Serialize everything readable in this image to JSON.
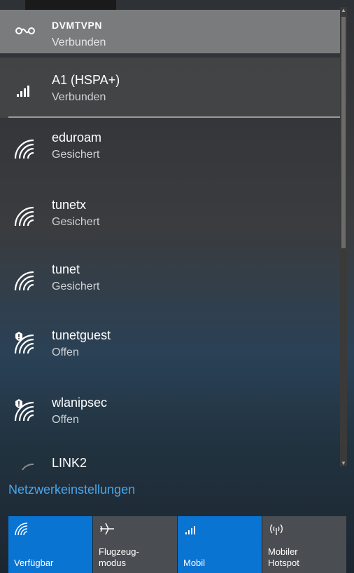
{
  "vpn": {
    "name": "DVMTVPN",
    "status": "Verbunden"
  },
  "cellular": {
    "name": "A1 (HSPA+)",
    "status": "Verbunden"
  },
  "wifi": [
    {
      "name": "eduroam",
      "status": "Gesichert",
      "secured": true
    },
    {
      "name": "tunetx",
      "status": "Gesichert",
      "secured": true
    },
    {
      "name": "tunet",
      "status": "Gesichert",
      "secured": true
    },
    {
      "name": "tunetguest",
      "status": "Offen",
      "secured": false
    },
    {
      "name": "wlanipsec",
      "status": "Offen",
      "secured": false
    },
    {
      "name": "LINK2",
      "status": "",
      "secured": true
    }
  ],
  "settings_link": "Netzwerkeinstellungen",
  "tiles": [
    {
      "label": "Verfügbar",
      "icon": "wifi-icon",
      "active": true
    },
    {
      "label": "Flugzeug-\nmodus",
      "icon": "airplane-icon",
      "active": false
    },
    {
      "label": "Mobil",
      "icon": "cellular-signal-icon",
      "active": true
    },
    {
      "label": "Mobiler\nHotspot",
      "icon": "hotspot-icon",
      "active": false
    }
  ],
  "colors": {
    "accent": "#0a74d3",
    "link": "#4aa6ea"
  }
}
